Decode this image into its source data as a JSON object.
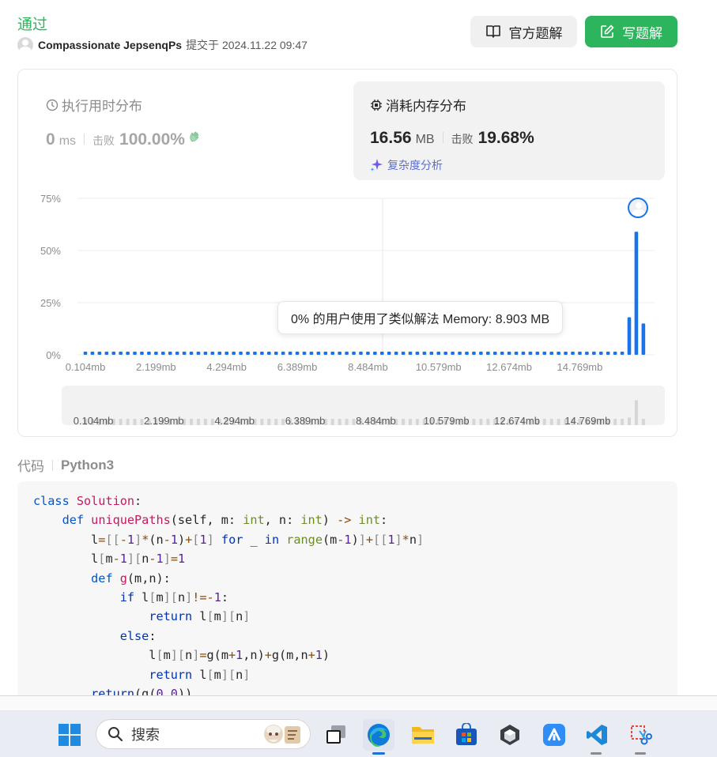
{
  "header": {
    "status": "通过",
    "author": "Compassionate JepsenqPs",
    "submitted": "提交于 2024.11.22 09:47",
    "official_btn": "官方题解",
    "write_btn": "写题解"
  },
  "runtime": {
    "label": "执行用时分布",
    "value": "0",
    "unit": "ms",
    "beat_label": "击败",
    "beat": "100.00%"
  },
  "memory": {
    "label": "消耗内存分布",
    "value": "16.56",
    "unit": "MB",
    "beat_label": "击败",
    "beat": "19.68%",
    "complexity": "复杂度分析"
  },
  "chart_data": {
    "type": "bar",
    "yticks": [
      "75%",
      "50%",
      "25%",
      "0%"
    ],
    "ylim": [
      0,
      75
    ],
    "xticks": [
      "0.104mb",
      "2.199mb",
      "4.294mb",
      "6.389mb",
      "8.484mb",
      "10.579mb",
      "12.674mb",
      "14.769mb"
    ],
    "bar_count": 80,
    "baseline_value": 1.5,
    "peaks": [
      {
        "index": 77,
        "value": 18
      },
      {
        "index": 78,
        "value": 59
      },
      {
        "index": 79,
        "value": 15
      }
    ],
    "tooltip": "0% 的用户使用了类似解法 Memory: 8.903 MB",
    "color": "#1a73e8"
  },
  "code_section": {
    "label": "代码",
    "language": "Python3"
  },
  "taskbar": {
    "search_placeholder": "搜索"
  }
}
